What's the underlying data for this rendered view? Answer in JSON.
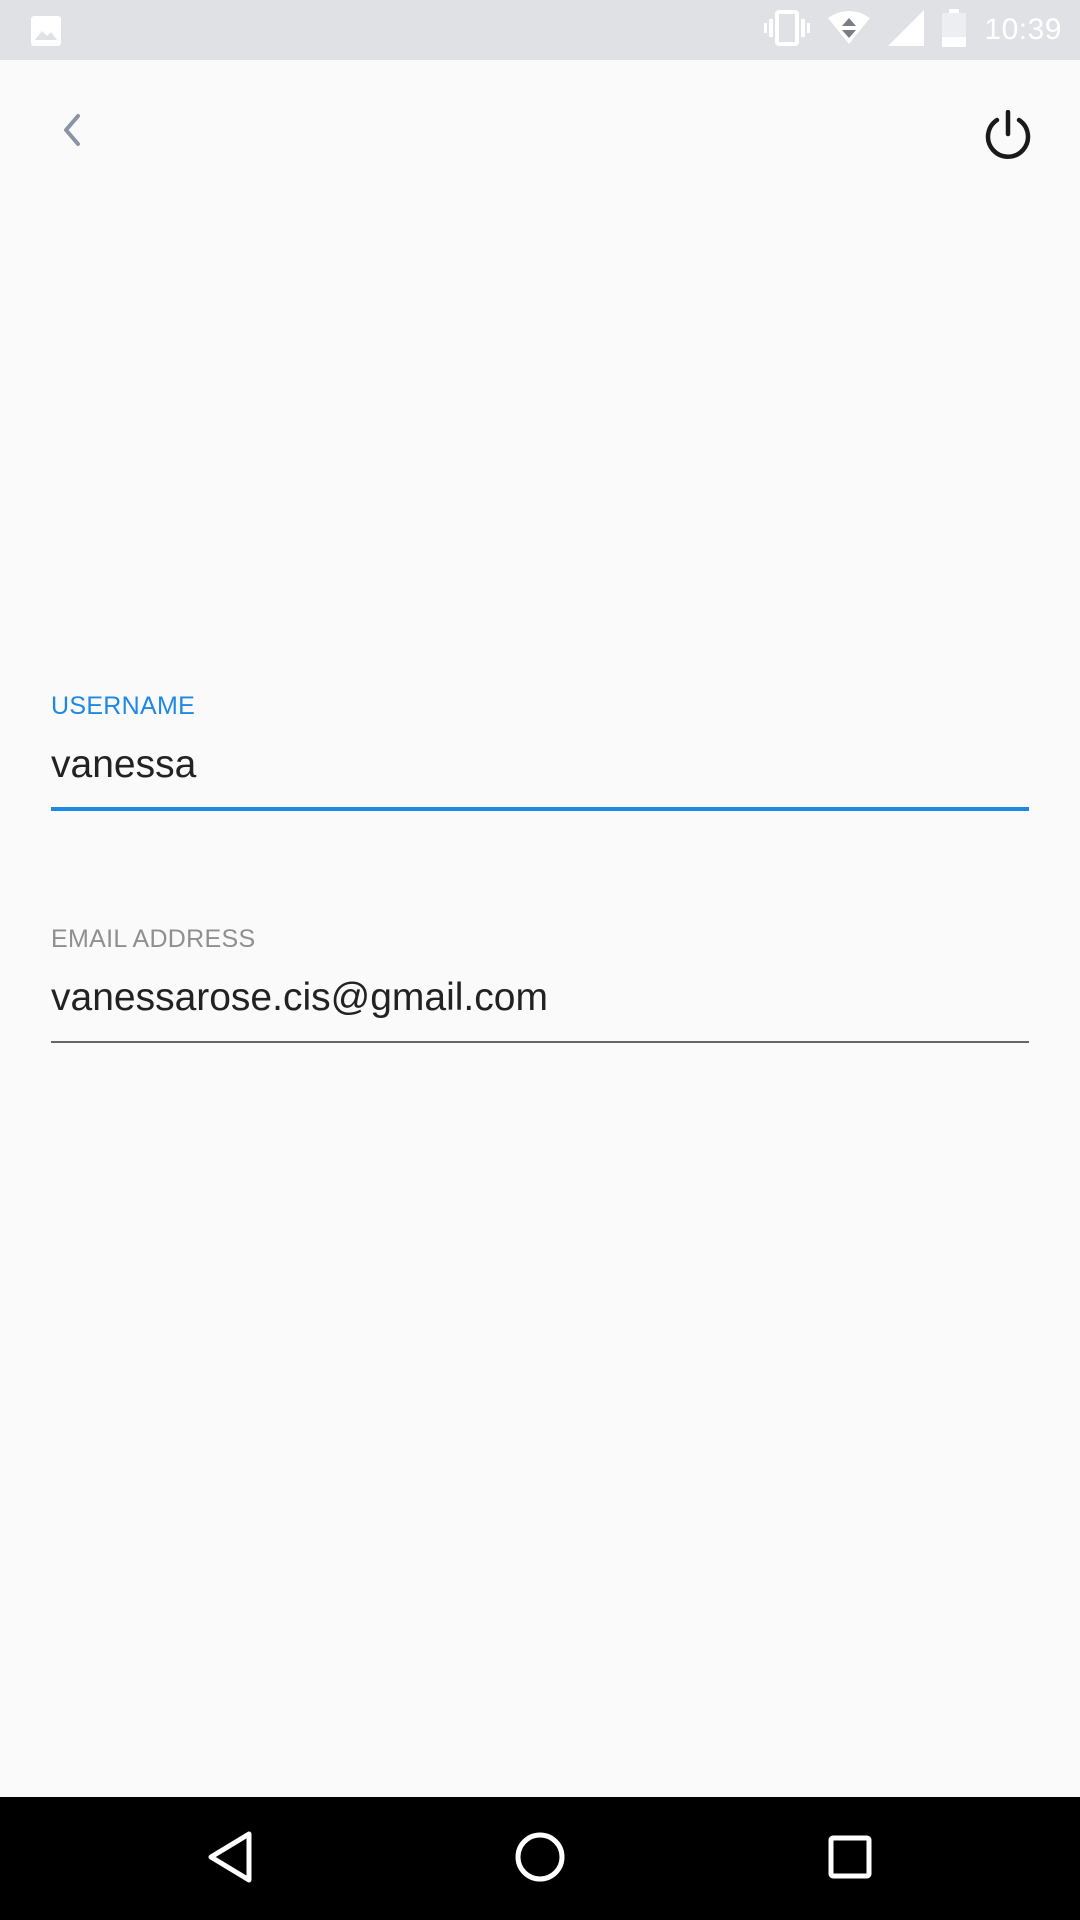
{
  "status_bar": {
    "time": "10:39",
    "icons": [
      "image-notification-icon",
      "vibrate-icon",
      "wifi-icon",
      "cell-signal-icon",
      "battery-icon"
    ]
  },
  "app_bar": {
    "back_icon": "chevron-left-icon",
    "power_icon": "power-icon"
  },
  "form": {
    "username": {
      "label": "USERNAME",
      "value": "vanessa",
      "state": "focused"
    },
    "email": {
      "label": "EMAIL ADDRESS",
      "value": "vanessarose.cis@gmail.com"
    }
  },
  "colors": {
    "accent": "#1e88e5",
    "background": "#fafafa",
    "status_bar": "#dfe1e5",
    "nav_bar": "#000000",
    "label_inactive": "#8f8f8f"
  },
  "nav_bar": {
    "icons": [
      "nav-back-icon",
      "nav-home-icon",
      "nav-recents-icon"
    ]
  }
}
